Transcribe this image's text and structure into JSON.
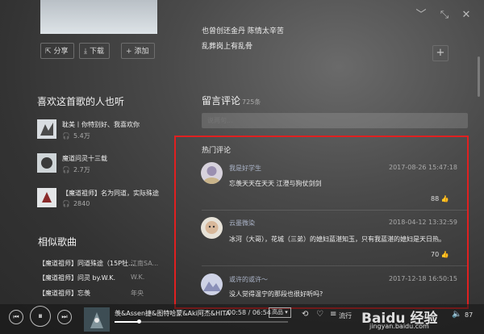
{
  "window": {
    "min_icon": "﹀",
    "shrink_icon": "⤡",
    "close_icon": "✕"
  },
  "lyrics": [
    "也曾创还金丹 陈情太辛苦",
    "乱葬岗上有乱骨"
  ],
  "actions": {
    "share": "分享",
    "download": "下载",
    "add": "添加",
    "plus": "+"
  },
  "recommend": {
    "title": "喜欢这首歌的人也听",
    "items": [
      {
        "title": "耽美丨你特别好、我喜欢你",
        "plays": "5.4万"
      },
      {
        "title": "魔道问灵十三载",
        "plays": "2.7万"
      },
      {
        "title": "【魔道祖师】名为同道，实际殊途",
        "plays": "2840"
      }
    ]
  },
  "comments": {
    "title": "留言评论",
    "count": "725条",
    "placeholder": "说两句...",
    "hot_title": "热门评论",
    "items": [
      {
        "user": "我是好学生",
        "date": "2017-08-26 15:47:18",
        "text": "忘羡天天在天天 江澄与狗仗剑剑",
        "likes": "88"
      },
      {
        "user": "云墨微染",
        "date": "2018-04-12 13:32:59",
        "text": "冰河（大哥），花城（三弟）的媳妇蓝湛知玉，只有我蓝湛的媳妇是天日热。",
        "likes": "70"
      },
      {
        "user": "或许的或许～",
        "date": "2017-12-18 16:50:15",
        "text": "没人觉得温宁的那段也很好听吗?",
        "likes": ""
      }
    ]
  },
  "similar": {
    "title": "相似歌曲",
    "items": [
      {
        "title": "【魔道祖师】同道殊途（15P牡...",
        "artist": "江南SA..."
      },
      {
        "title": "【魔道祖师】问灵 by.W.K.",
        "artist": "W.K."
      },
      {
        "title": "【魔道祖师】忘羡",
        "artist": "年央"
      }
    ]
  },
  "player": {
    "title": "羡&Assen捷&图特哈蒙&Aki阿杰&HITA",
    "time": "00:58 / 06:54",
    "quality": "高品",
    "progress": 0.14,
    "mode_label": "流行",
    "volume": "87",
    "prev_icon": "⏮",
    "pause_icon": "⏸",
    "next_icon": "⏭"
  },
  "watermark": {
    "main": "Baidu 经验",
    "sub": "jingyan.baidu.com"
  },
  "colors": {
    "highlight_box": "#e02020",
    "progress": "#ffffff"
  }
}
